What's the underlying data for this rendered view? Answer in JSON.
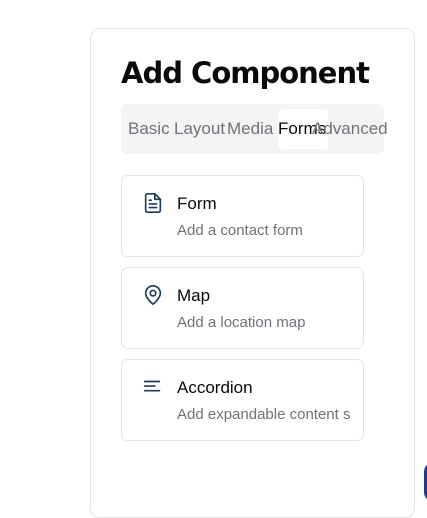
{
  "panel": {
    "title": "Add Component"
  },
  "tabs": [
    {
      "label": "Basic",
      "active": false
    },
    {
      "label": "Layout",
      "active": false
    },
    {
      "label": "Media",
      "active": false
    },
    {
      "label": "Forms",
      "active": true
    },
    {
      "label": "Advanced",
      "active": false
    }
  ],
  "components": [
    {
      "name": "Form",
      "description": "Add a contact form",
      "icon": "document-icon"
    },
    {
      "name": "Map",
      "description": "Add a location map",
      "icon": "map-pin-icon"
    },
    {
      "name": "Accordion",
      "description": "Add expandable content s",
      "icon": "align-left-icon"
    }
  ],
  "colors": {
    "icon": "#1e3a5f",
    "active_tab_bg": "#ffffff",
    "tabs_bg": "#f4f4f5"
  }
}
